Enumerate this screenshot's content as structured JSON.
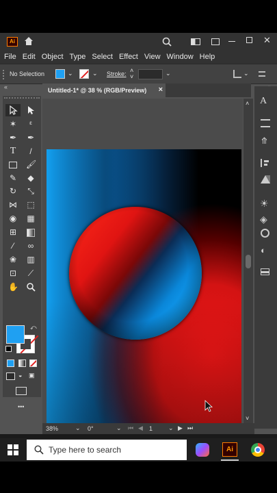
{
  "app": {
    "logo": "Ai"
  },
  "menu": [
    "File",
    "Edit",
    "Object",
    "Type",
    "Select",
    "Effect",
    "View",
    "Window",
    "Help"
  ],
  "control": {
    "selection": "No Selection",
    "stroke_label": "Stroke:"
  },
  "tab": {
    "title": "Untitled-1* @ 38 % (RGB/Preview)",
    "close": "×"
  },
  "status": {
    "zoom": "38%",
    "rotation": "0°",
    "page": "1"
  },
  "taskbar": {
    "search_placeholder": "Type here to search",
    "ai_label": "Ai"
  },
  "colors": {
    "fill": "#1fa0f2",
    "accent_red": "#e02020",
    "panel": "#535353"
  },
  "icons": [
    "home-icon",
    "search-icon",
    "workspace-icon",
    "panel-icon",
    "minimize-icon",
    "restore-icon",
    "close-icon"
  ]
}
